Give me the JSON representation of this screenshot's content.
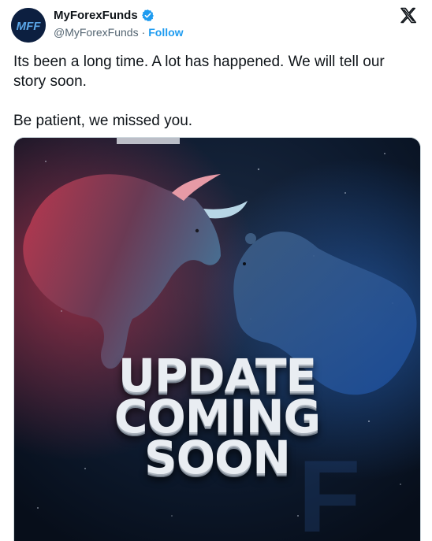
{
  "header": {
    "avatar_text": "MFF",
    "display_name": "MyForexFunds",
    "handle": "@MyForexFunds",
    "separator": "·",
    "follow_label": "Follow"
  },
  "tweet": {
    "paragraph_1": "Its been a long time. A lot has happened. We will tell our story soon.",
    "paragraph_2": "Be patient, we missed you."
  },
  "media": {
    "line_1": "UPDATE",
    "line_2": "COMING",
    "line_3": "SOON"
  },
  "colors": {
    "accent": "#1d9bf0",
    "text": "#0f1419",
    "muted": "#536471"
  },
  "icons": {
    "verified": "verified-badge-icon",
    "platform": "x-logo-icon"
  }
}
